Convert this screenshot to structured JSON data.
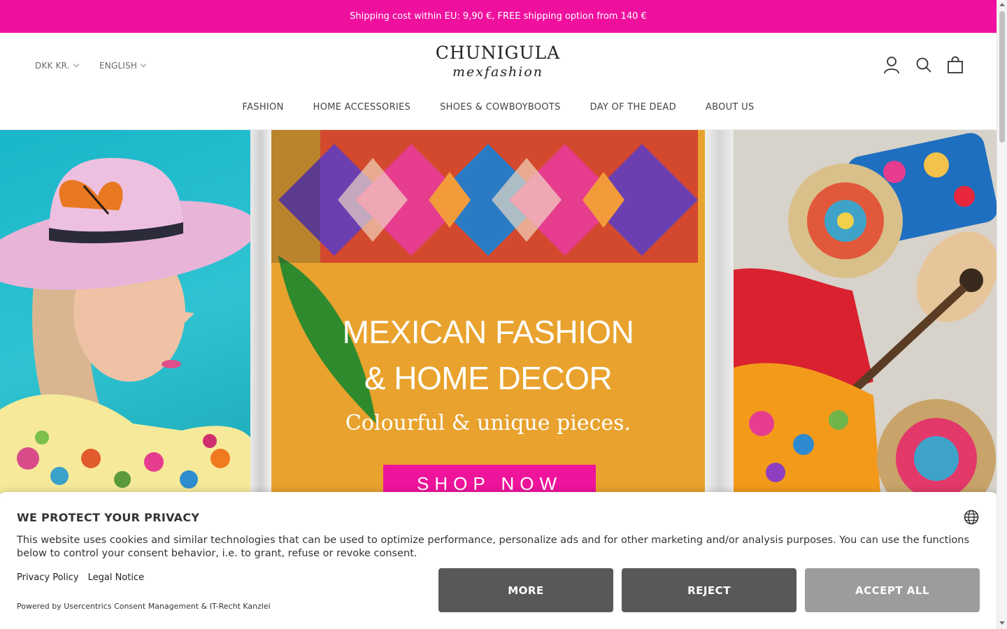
{
  "announcement": "Shipping cost within EU: 9,90 €, FREE shipping option from 140 €",
  "header": {
    "currency": "DKK KR.",
    "language": "ENGLISH",
    "logo_line1": "CHUNIGULA",
    "logo_line2": "mexfashion",
    "icons": [
      "account-icon",
      "search-icon",
      "cart-icon"
    ]
  },
  "nav": [
    "FASHION",
    "HOME ACCESSORIES",
    "SHOES & COWBOYBOOTS",
    "DAY OF THE DEAD",
    "ABOUT US"
  ],
  "hero": {
    "title_line1": "MEXICAN FASHION",
    "title_line2": "& HOME DECOR",
    "subtitle": "Colourful & unique pieces.",
    "cta": "SHOP NOW",
    "accent": "#ee149c"
  },
  "consent": {
    "title": "WE PROTECT YOUR PRIVACY",
    "text": "This website uses cookies and similar technologies that can be used to optimize performance, personalize ads and for other marketing and/or analysis purposes. You can use the functions below to control your consent behavior, i.e. to grant, refuse or revoke consent.",
    "links": [
      "Privacy Policy",
      "Legal Notice"
    ],
    "powered_by": "Powered by Usercentrics Consent Management & IT-Recht Kanzlei",
    "buttons": {
      "more": "MORE",
      "reject": "REJECT",
      "accept": "ACCEPT ALL"
    }
  },
  "colors": {
    "brand_pink": "#f0109e",
    "button_dark": "#585858",
    "button_light": "#9c9c9c"
  }
}
